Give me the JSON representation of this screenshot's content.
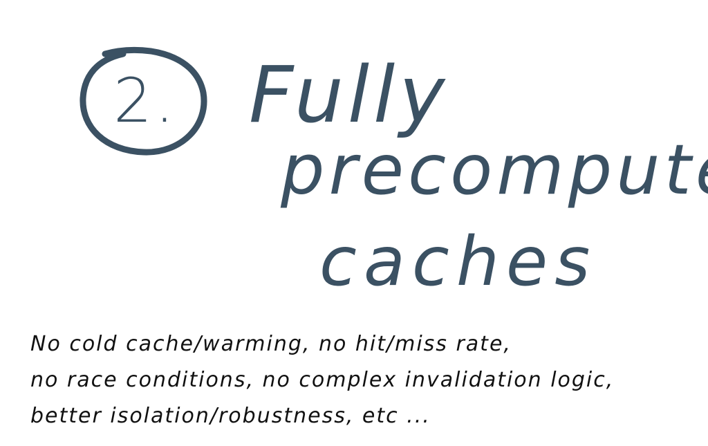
{
  "slide": {
    "number": "2.",
    "title_lines": [
      "Fully",
      "precomputed",
      "caches"
    ],
    "notes_lines": [
      "No cold cache/warming, no hit/miss rate,",
      "no race conditions, no complex invalidation logic,",
      "better isolation/robustness, etc ..."
    ],
    "colors": {
      "title": "#3b5163",
      "notes": "#111111",
      "background": "#ffffff"
    }
  }
}
